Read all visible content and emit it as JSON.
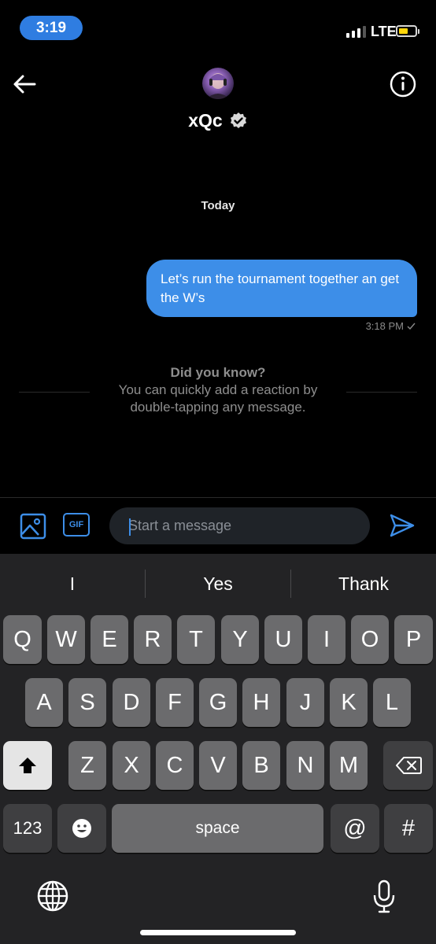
{
  "status": {
    "time": "3:19",
    "network": "LTE",
    "battery_color": "#ffd60a"
  },
  "header": {
    "contact_name": "xQc",
    "verified_icon": "verified-badge-icon",
    "back_icon": "arrow-left-icon",
    "info_icon": "info-icon"
  },
  "conversation": {
    "day_label": "Today",
    "messages": [
      {
        "text": "Let’s run the tournament together an get the W’s",
        "time": "3:18 PM",
        "status_icon": "check-icon",
        "from_me": true
      }
    ],
    "tip": {
      "title": "Did you know?",
      "body_line1": "You can quickly add a reaction by",
      "body_line2": "double-tapping any message."
    }
  },
  "composer": {
    "placeholder": "Start a message",
    "image_icon": "image-icon",
    "gif_label": "GIF",
    "send_icon": "send-icon",
    "accent": "#3d8ee8"
  },
  "keyboard": {
    "suggestions": [
      "I",
      "Yes",
      "Thank"
    ],
    "row1": [
      "Q",
      "W",
      "E",
      "R",
      "T",
      "Y",
      "U",
      "I",
      "O",
      "P"
    ],
    "row2": [
      "A",
      "S",
      "D",
      "F",
      "G",
      "H",
      "J",
      "K",
      "L"
    ],
    "row3": [
      "Z",
      "X",
      "C",
      "V",
      "B",
      "N",
      "M"
    ],
    "numbers_label": "123",
    "space_label": "space",
    "at_label": "@",
    "hash_label": "#",
    "shift_icon": "shift-icon",
    "delete_icon": "backspace-icon",
    "emoji_icon": "emoji-icon",
    "globe_icon": "globe-icon",
    "mic_icon": "microphone-icon"
  }
}
